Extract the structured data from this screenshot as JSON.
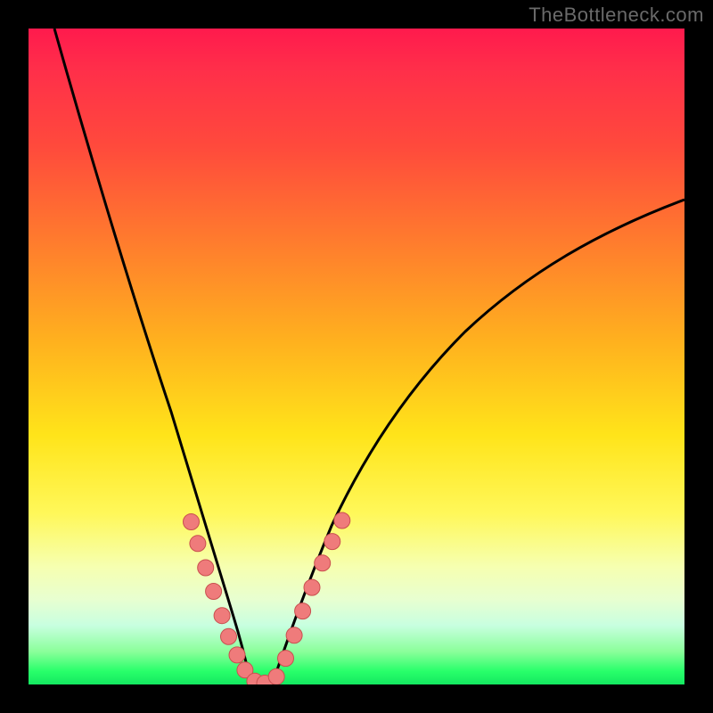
{
  "watermark": "TheBottleneck.com",
  "colors": {
    "frame": "#000000",
    "gradient_top": "#ff1a4d",
    "gradient_mid": "#ffe41a",
    "gradient_bottom": "#14e860",
    "curve_stroke": "#000000",
    "dot_fill": "#ef7b7b"
  },
  "chart_data": {
    "type": "line",
    "title": "",
    "xlabel": "",
    "ylabel": "",
    "xlim": [
      0,
      1
    ],
    "ylim": [
      0,
      1
    ],
    "note": "No axis ticks, labels, or units are rendered; values below are normalized pixel-space coordinates (origin top-left of plot area).",
    "series": [
      {
        "name": "left-curve",
        "x": [
          0.04,
          0.075,
          0.11,
          0.145,
          0.18,
          0.205,
          0.23,
          0.255,
          0.275,
          0.295,
          0.31,
          0.325
        ],
        "y": [
          0.0,
          0.13,
          0.27,
          0.4,
          0.52,
          0.61,
          0.69,
          0.77,
          0.84,
          0.9,
          0.95,
          0.99
        ]
      },
      {
        "name": "valley-floor",
        "x": [
          0.325,
          0.35,
          0.375
        ],
        "y": [
          0.99,
          0.995,
          0.99
        ]
      },
      {
        "name": "right-curve",
        "x": [
          0.375,
          0.395,
          0.42,
          0.45,
          0.49,
          0.54,
          0.6,
          0.67,
          0.75,
          0.83,
          0.91,
          1.0
        ],
        "y": [
          0.99,
          0.945,
          0.88,
          0.81,
          0.73,
          0.65,
          0.57,
          0.49,
          0.42,
          0.36,
          0.31,
          0.265
        ]
      }
    ],
    "markers": [
      {
        "name": "left-dots",
        "x": [
          0.248,
          0.258,
          0.27,
          0.282,
          0.295,
          0.305,
          0.318,
          0.33,
          0.345,
          0.36
        ],
        "y": [
          0.752,
          0.785,
          0.822,
          0.858,
          0.895,
          0.927,
          0.955,
          0.978,
          0.995,
          0.998
        ]
      },
      {
        "name": "right-dots",
        "x": [
          0.378,
          0.392,
          0.405,
          0.418,
          0.432,
          0.448,
          0.463,
          0.478
        ],
        "y": [
          0.988,
          0.96,
          0.925,
          0.888,
          0.852,
          0.815,
          0.782,
          0.75
        ]
      }
    ]
  }
}
